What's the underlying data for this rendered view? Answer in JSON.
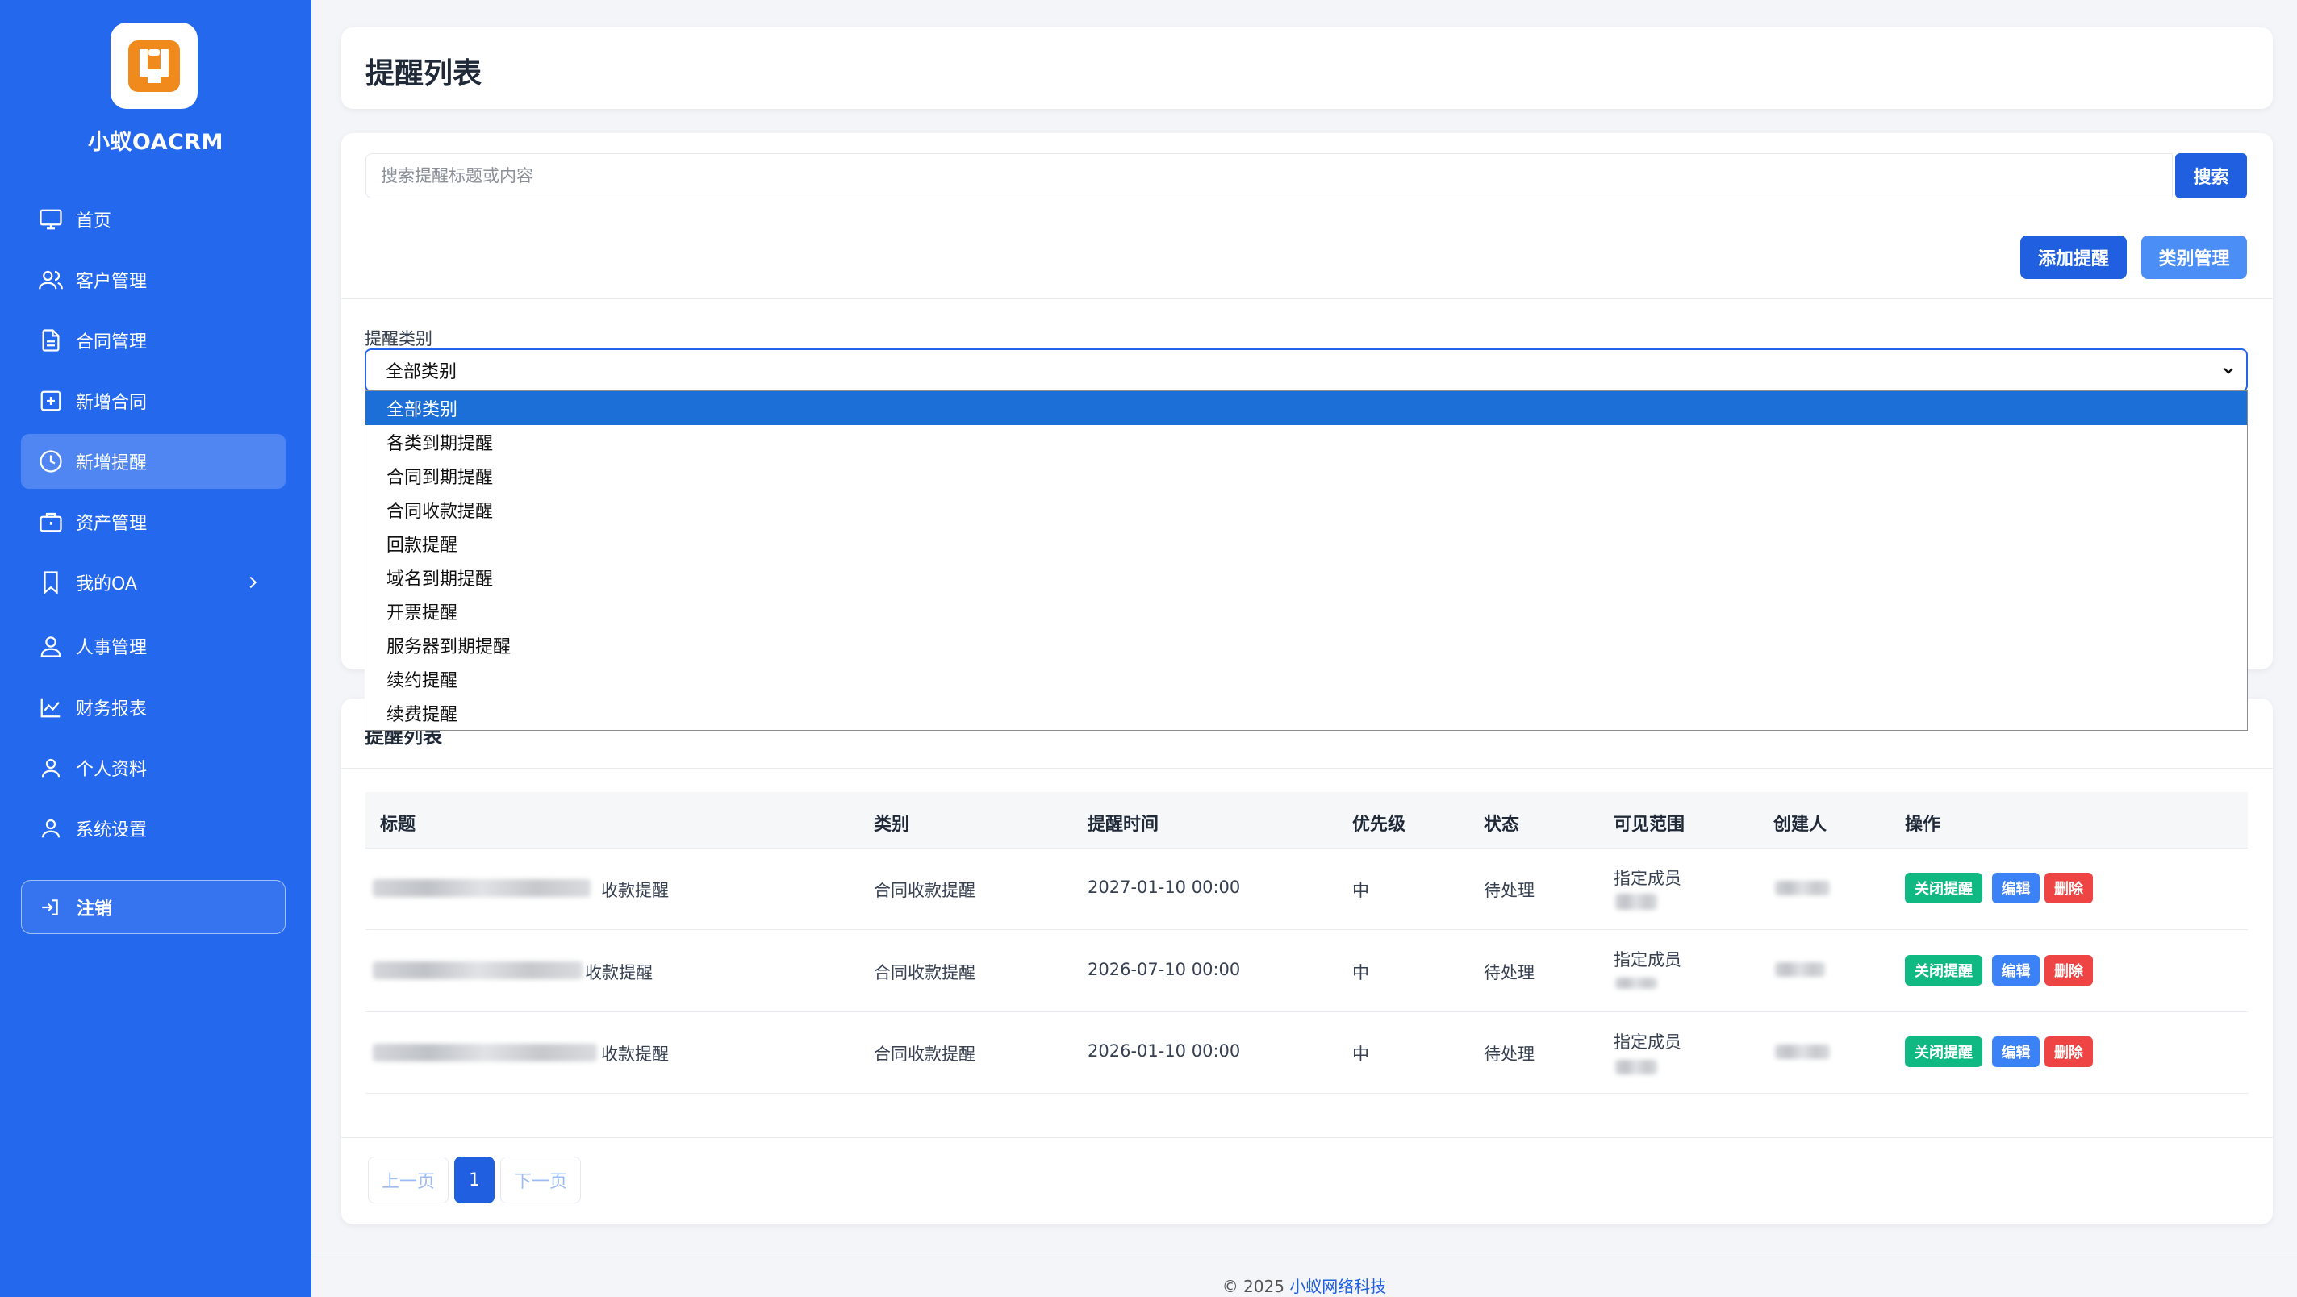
{
  "app": {
    "name": "小蚁OACRM"
  },
  "sidebar": {
    "items": [
      {
        "label": "首页",
        "icon": "monitor-icon"
      },
      {
        "label": "客户管理",
        "icon": "users-icon"
      },
      {
        "label": "合同管理",
        "icon": "document-icon"
      },
      {
        "label": "新增合同",
        "icon": "plus-square-icon"
      },
      {
        "label": "新增提醒",
        "icon": "clock-icon",
        "active": true
      },
      {
        "label": "资产管理",
        "icon": "briefcase-icon"
      },
      {
        "label": "我的OA",
        "icon": "bookmark-icon",
        "has_submenu": true
      },
      {
        "label": "人事管理",
        "icon": "user-icon"
      },
      {
        "label": "财务报表",
        "icon": "chart-icon"
      },
      {
        "label": "个人资料",
        "icon": "person-icon"
      },
      {
        "label": "系统设置",
        "icon": "settings-user-icon"
      }
    ],
    "logout_label": "注销"
  },
  "header": {
    "title": "提醒列表"
  },
  "search": {
    "placeholder": "搜索提醒标题或内容",
    "button_label": "搜索"
  },
  "toolbar": {
    "add_label": "添加提醒",
    "category_label": "类别管理"
  },
  "filter": {
    "label": "提醒类别",
    "selected": "全部类别",
    "options": [
      "全部类别",
      "各类到期提醒",
      "合同到期提醒",
      "合同收款提醒",
      "回款提醒",
      "域名到期提醒",
      "开票提醒",
      "服务器到期提醒",
      "续约提醒",
      "续费提醒"
    ]
  },
  "list": {
    "title": "提醒列表",
    "columns": [
      "标题",
      "类别",
      "提醒时间",
      "优先级",
      "状态",
      "可见范围",
      "创建人",
      "操作"
    ],
    "rows": [
      {
        "title_suffix": "收款提醒",
        "category": "合同收款提醒",
        "time": "2027-01-10 00:00",
        "priority": "中",
        "status": "待处理",
        "scope": "指定成员"
      },
      {
        "title_suffix": "收款提醒",
        "category": "合同收款提醒",
        "time": "2026-07-10 00:00",
        "priority": "中",
        "status": "待处理",
        "scope": "指定成员"
      },
      {
        "title_suffix": "收款提醒",
        "category": "合同收款提醒",
        "time": "2026-01-10 00:00",
        "priority": "中",
        "status": "待处理",
        "scope": "指定成员"
      }
    ],
    "actions": {
      "close": "关闭提醒",
      "edit": "编辑",
      "delete": "删除"
    }
  },
  "pagination": {
    "prev": "上一页",
    "current": "1",
    "next": "下一页"
  },
  "footer": {
    "copyright": "© 2025",
    "company": "小蚁网络科技"
  },
  "colors": {
    "sidebar": "#2468ee",
    "primary": "#1f5fe0",
    "success": "#10b981",
    "danger": "#ef4444",
    "logo": "#f08a1c"
  }
}
